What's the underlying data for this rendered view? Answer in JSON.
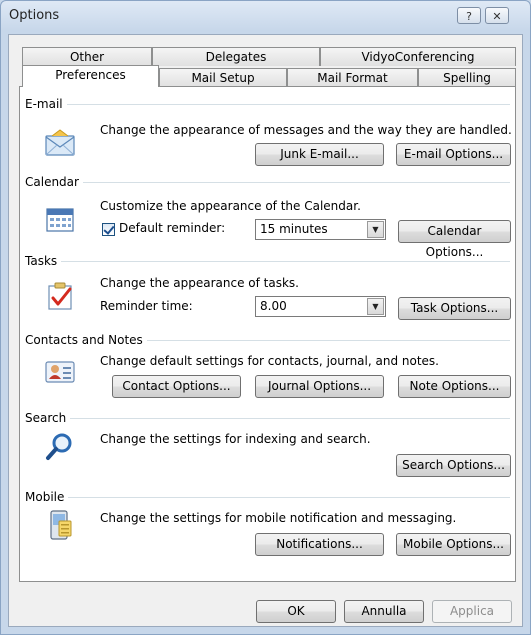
{
  "window": {
    "title": "Options",
    "help_label": "?",
    "close_label": "✕"
  },
  "tabs_row1": [
    "Other",
    "Delegates",
    "VidyoConferencing"
  ],
  "tabs_row2": [
    "Preferences",
    "Mail Setup",
    "Mail Format",
    "Spelling"
  ],
  "email": {
    "title": "E-mail",
    "desc": "Change the appearance of messages and the way they are handled.",
    "junk_label": "Junk E-mail...",
    "options_label": "E-mail Options..."
  },
  "calendar": {
    "title": "Calendar",
    "desc": "Customize the appearance of the Calendar.",
    "reminder_label": "Default reminder:",
    "reminder_checked": true,
    "reminder_value": "15 minutes",
    "options_label": "Calendar Options..."
  },
  "tasks": {
    "title": "Tasks",
    "desc": "Change the appearance of tasks.",
    "reminder_label": "Reminder time:",
    "reminder_value": "8.00",
    "options_label": "Task Options..."
  },
  "contacts": {
    "title": "Contacts and Notes",
    "desc": "Change default settings for contacts, journal, and notes.",
    "contact_label": "Contact Options...",
    "journal_label": "Journal Options...",
    "note_label": "Note Options..."
  },
  "search": {
    "title": "Search",
    "desc": "Change the settings for indexing and search.",
    "options_label": "Search Options..."
  },
  "mobile": {
    "title": "Mobile",
    "desc": "Change the settings for mobile notification and messaging.",
    "notifications_label": "Notifications...",
    "options_label": "Mobile Options..."
  },
  "footer": {
    "ok_label": "OK",
    "cancel_label": "Annulla",
    "apply_label": "Applica"
  },
  "icons": {
    "email": "envelope-icon",
    "calendar": "calendar-icon",
    "tasks": "task-checkmark-icon",
    "contacts": "contact-card-icon",
    "search": "magnifier-icon",
    "mobile": "mobile-device-icon"
  }
}
